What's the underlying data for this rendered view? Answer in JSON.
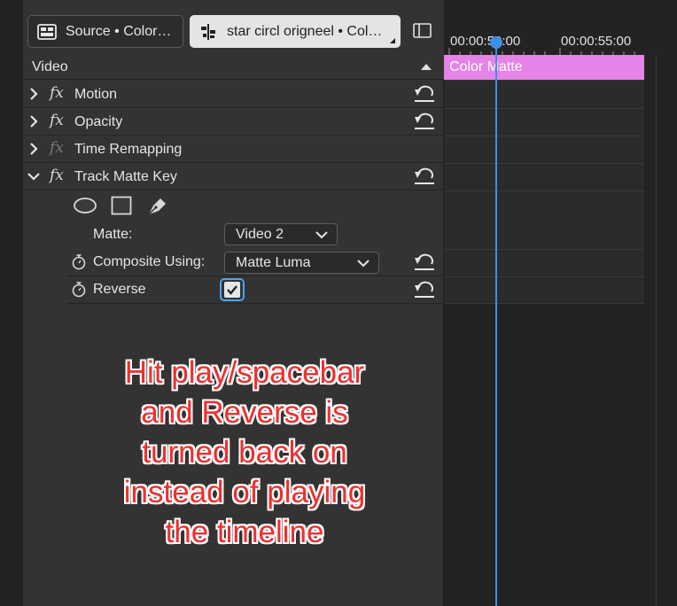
{
  "tabs": {
    "source_label": "Source • Color…",
    "active_label": "star circl origneel • Col…"
  },
  "video_section": {
    "header": "Video"
  },
  "effects": [
    {
      "name": "Motion",
      "expanded": false,
      "fx_enabled": true,
      "has_reset": true
    },
    {
      "name": "Opacity",
      "expanded": false,
      "fx_enabled": true,
      "has_reset": true
    },
    {
      "name": "Time Remapping",
      "expanded": false,
      "fx_enabled": false,
      "has_reset": false
    },
    {
      "name": "Track Matte Key",
      "expanded": true,
      "fx_enabled": true,
      "has_reset": true
    }
  ],
  "mask_tools": [
    "ellipse-mask-icon",
    "rectangle-mask-icon",
    "pen-mask-icon"
  ],
  "properties": {
    "matte": {
      "label": "Matte:",
      "value": "Video 2"
    },
    "composite": {
      "label": "Composite Using:",
      "value": "Matte Luma"
    },
    "reverse": {
      "label": "Reverse",
      "checked": true
    }
  },
  "timeline": {
    "time_left": "00:00:50:00",
    "time_right": "00:00:55:00",
    "clip_label": "Color Matte"
  },
  "annotation": {
    "lines": [
      "Hit play/spacebar",
      "and Reverse is",
      "turned back on",
      "instead of playing",
      "the timeline"
    ]
  },
  "colors": {
    "accent": "#3d8fe8",
    "clip": "#e683e6",
    "annotation_text": "#ee2f2f"
  }
}
